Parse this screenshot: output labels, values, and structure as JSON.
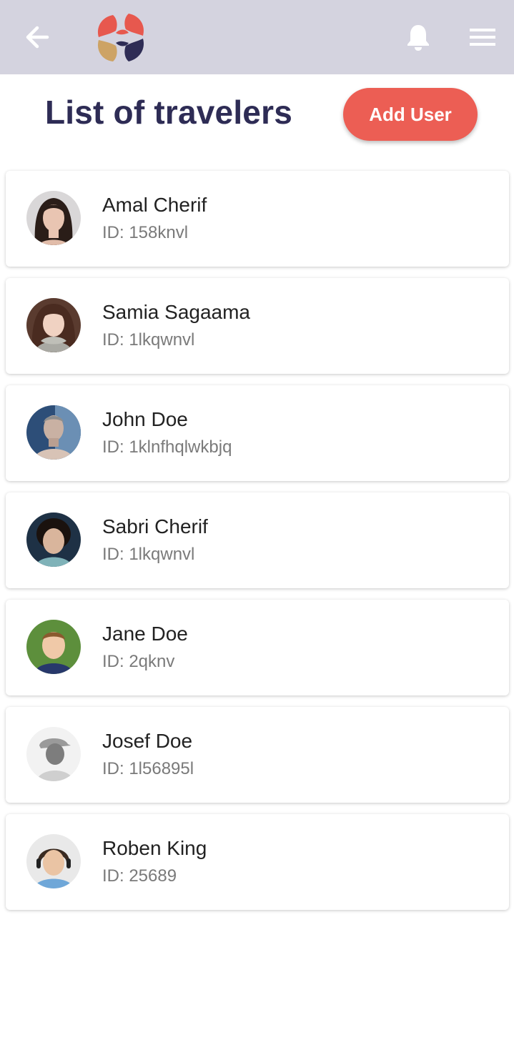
{
  "header": {
    "back_icon": "arrow-left-icon",
    "logo": "brand-logo",
    "notification_icon": "bell-icon",
    "menu_icon": "hamburger-menu-icon",
    "background_color": "#d4d3df"
  },
  "page": {
    "title": "List of travelers",
    "add_user_label": "Add User",
    "title_color": "#2e2c55",
    "accent_color": "#ec5e54"
  },
  "travelers": [
    {
      "name": "Amal Cherif",
      "id": "ID: 158knvl"
    },
    {
      "name": "Samia Sagaama",
      "id": "ID: 1lkqwnvl"
    },
    {
      "name": "John Doe",
      "id": "ID: 1klnfhqlwkbjq"
    },
    {
      "name": "Sabri Cherif",
      "id": "ID: 1lkqwnvl"
    },
    {
      "name": "Jane Doe",
      "id": "ID: 2qknv"
    },
    {
      "name": "Josef Doe",
      "id": "ID: 1l56895l"
    },
    {
      "name": "Roben King",
      "id": "ID: 25689"
    }
  ]
}
